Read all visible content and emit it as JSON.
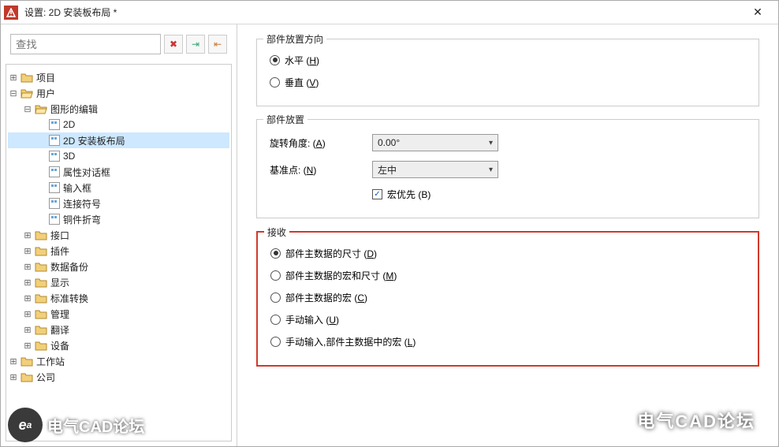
{
  "window": {
    "title": "设置: 2D 安装板布局 *"
  },
  "search": {
    "placeholder": "查找"
  },
  "icons": {
    "close": "✕",
    "clear": "✖",
    "import": "⇥",
    "export": "⇤"
  },
  "tree": {
    "n0": {
      "label": "项目"
    },
    "n1": {
      "label": "用户"
    },
    "n2": {
      "label": "图形的编辑"
    },
    "n3": {
      "label": "2D"
    },
    "n4": {
      "label": "2D 安装板布局"
    },
    "n5": {
      "label": "3D"
    },
    "n6": {
      "label": "属性对话框"
    },
    "n7": {
      "label": "输入框"
    },
    "n8": {
      "label": "连接符号"
    },
    "n9": {
      "label": "铜件折弯"
    },
    "n10": {
      "label": "接口"
    },
    "n11": {
      "label": "插件"
    },
    "n12": {
      "label": "数据备份"
    },
    "n13": {
      "label": "显示"
    },
    "n14": {
      "label": "标准转换"
    },
    "n15": {
      "label": "管理"
    },
    "n16": {
      "label": "翻译"
    },
    "n17": {
      "label": "设备"
    },
    "n18": {
      "label": "工作站"
    },
    "n19": {
      "label": "公司"
    }
  },
  "groups": {
    "orient": {
      "legend": "部件放置方向",
      "horizontal_pre": "水平 (",
      "horizontal_u": "H",
      "horizontal_post": ")",
      "vertical_pre": "垂直 (",
      "vertical_u": "V",
      "vertical_post": ")"
    },
    "place": {
      "legend": "部件放置",
      "rotation_lbl_pre": "旋转角度: (",
      "rotation_u": "A",
      "rotation_post": ")",
      "rotation_val": "0.00°",
      "base_lbl_pre": "基准点: (",
      "base_u": "N",
      "base_post": ")",
      "base_val": "左中",
      "macro_pre": "宏优先 (",
      "macro_u": "B",
      "macro_post": ")"
    },
    "accept": {
      "legend": "接收",
      "r1_pre": "部件主数据的尺寸 (",
      "r1_u": "D",
      "r1_post": ")",
      "r2_pre": "部件主数据的宏和尺寸 (",
      "r2_u": "M",
      "r2_post": ")",
      "r3_pre": "部件主数据的宏 (",
      "r3_u": "C",
      "r3_post": ")",
      "r4_pre": "手动输入  (",
      "r4_u": "U",
      "r4_post": ")",
      "r5_pre": "手动输入,部件主数据中的宏 (",
      "r5_u": "L",
      "r5_post": ")"
    }
  },
  "watermark": {
    "logo": "e",
    "sub": "a",
    "text": "电气CAD论坛"
  },
  "wechat": {
    "text": "电气CAD论坛"
  }
}
